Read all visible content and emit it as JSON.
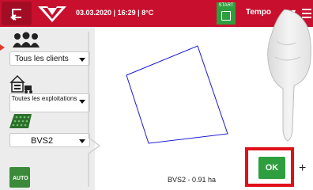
{
  "topbar": {
    "datetime": "03.03.2020 | 16:29 | 8°C",
    "start_label": "START",
    "temp_label": "Tempo",
    "colors": {
      "bar": "#c8102e",
      "start": "#2e9e3e"
    }
  },
  "left": {
    "clients_select": "Tous les clients",
    "exploit_select": "Toutes les exploitations",
    "field_select": "BVS2",
    "auto_label": "AUTO"
  },
  "map": {
    "parcel_label": "BVS2 - 0.91 ha",
    "outline_color": "#1a1ad6"
  },
  "actions": {
    "ok_label": "OK",
    "plus_label": "+",
    "highlight_color": "#e0101a"
  }
}
